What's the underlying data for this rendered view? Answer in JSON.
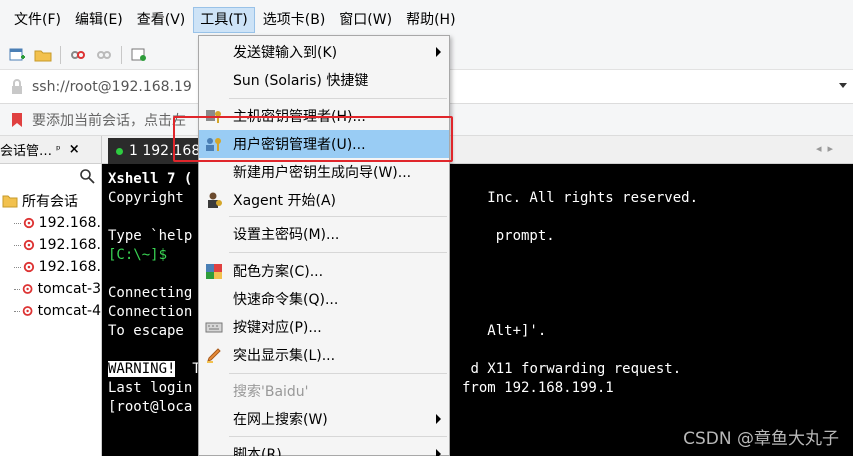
{
  "menubar": {
    "items": [
      "文件(F)",
      "编辑(E)",
      "查看(V)",
      "工具(T)",
      "选项卡(B)",
      "窗口(W)",
      "帮助(H)"
    ]
  },
  "address": {
    "text": "ssh://root@192.168.19"
  },
  "tip": {
    "text": "要添加当前会话，点击左"
  },
  "session_panel": {
    "title": "会话管…",
    "pin": "ᵖ",
    "close": "×",
    "root": "所有会话",
    "items": [
      "192.168.",
      "192.168.",
      "192.168.",
      "tomcat-3",
      "tomcat-4"
    ]
  },
  "tab": {
    "label": "1 192.168"
  },
  "terminal": {
    "lines": [
      "Xshell 7 (",
      "Copyright                                    Inc. All rights reserved.",
      "",
      "Type `help                                    prompt.",
      "[C:\\~]$",
      "",
      "Connecting",
      "Connection",
      "To escape                                    Alt+]'.",
      "",
      "WARNING!  T                                d X11 forwarding request.",
      "Last login                                from 192.168.199.1",
      "[root@loca"
    ],
    "warning_label": "WARNING!"
  },
  "watermark": "CSDN @章鱼大丸子",
  "dropdown": {
    "items": [
      {
        "label": "发送键输入到(K)",
        "submenu": true
      },
      {
        "label": "Sun (Solaris) 快捷键"
      },
      {
        "label": "主机密钥管理者(H)..."
      },
      {
        "label": "用户密钥管理者(U)...",
        "highlighted": true
      },
      {
        "label": "新建用户密钥生成向导(W)..."
      },
      {
        "label": "Xagent 开始(A)"
      },
      {
        "label": "设置主密码(M)..."
      },
      {
        "label": "配色方案(C)..."
      },
      {
        "label": "快速命令集(Q)..."
      },
      {
        "label": "按键对应(P)..."
      },
      {
        "label": "突出显示集(L)..."
      },
      {
        "label": "搜索'Baidu'",
        "disabled": true
      },
      {
        "label": "在网上搜索(W)",
        "submenu": true
      },
      {
        "label": "脚本(R)",
        "submenu": true
      }
    ]
  },
  "colors": {
    "highlight": "#99ccf4",
    "red_box": "#e0262b",
    "terminal_bg": "#000000",
    "prompt_green": "#39d353"
  }
}
